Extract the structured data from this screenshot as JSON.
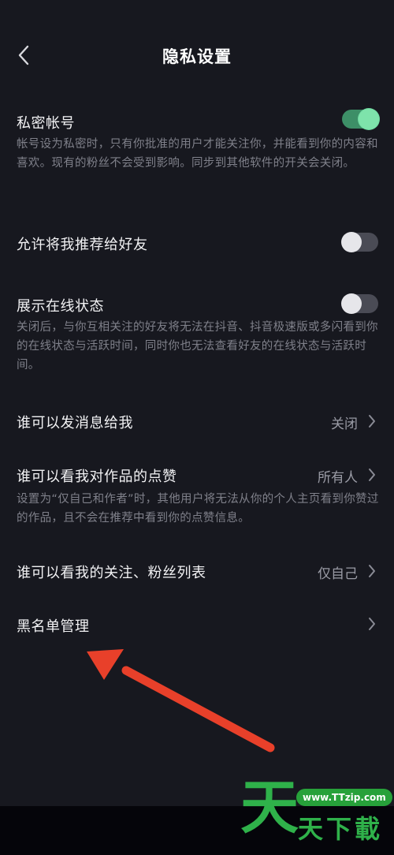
{
  "header": {
    "title": "隐私设置",
    "back_icon": "chevron-left-icon"
  },
  "private_account": {
    "label": "私密帐号",
    "description": "帐号设为私密时，只有你批准的用户才能关注你，并能看到你的内容和喜欢。现有的粉丝不会受到影响。同步到其他软件的开关会关闭。",
    "toggle_on": true
  },
  "recommend_to_friends": {
    "label": "允许将我推荐给好友",
    "toggle_on": false
  },
  "online_status": {
    "label": "展示在线状态",
    "description": "关闭后，与你互相关注的好友将无法在抖音、抖音极速版或多闪看到你的在线状态与活跃时间，同时你也无法查看好友的在线状态与活跃时间。",
    "toggle_on": false
  },
  "who_can_message": {
    "label": "谁可以发消息给我",
    "value": "关闭"
  },
  "who_can_see_likes": {
    "label": "谁可以看我对作品的点赞",
    "value": "所有人",
    "description": "设置为“仅自己和作者”时，其他用户将无法从你的个人主页看到你赞过的作品，且不会在推荐中看到你的点赞信息。"
  },
  "who_can_see_follow_list": {
    "label": "谁可以看我的关注、粉丝列表",
    "value": "仅自己"
  },
  "blacklist": {
    "label": "黑名单管理"
  },
  "watermark": {
    "url": "www.TTzip.com",
    "big_char": "天",
    "small_text": "天下載"
  },
  "colors": {
    "background": "#17181f",
    "toggle_on": "#7ee3ab",
    "arrow": "#e8402a",
    "watermark_green": "#2fb14a"
  }
}
